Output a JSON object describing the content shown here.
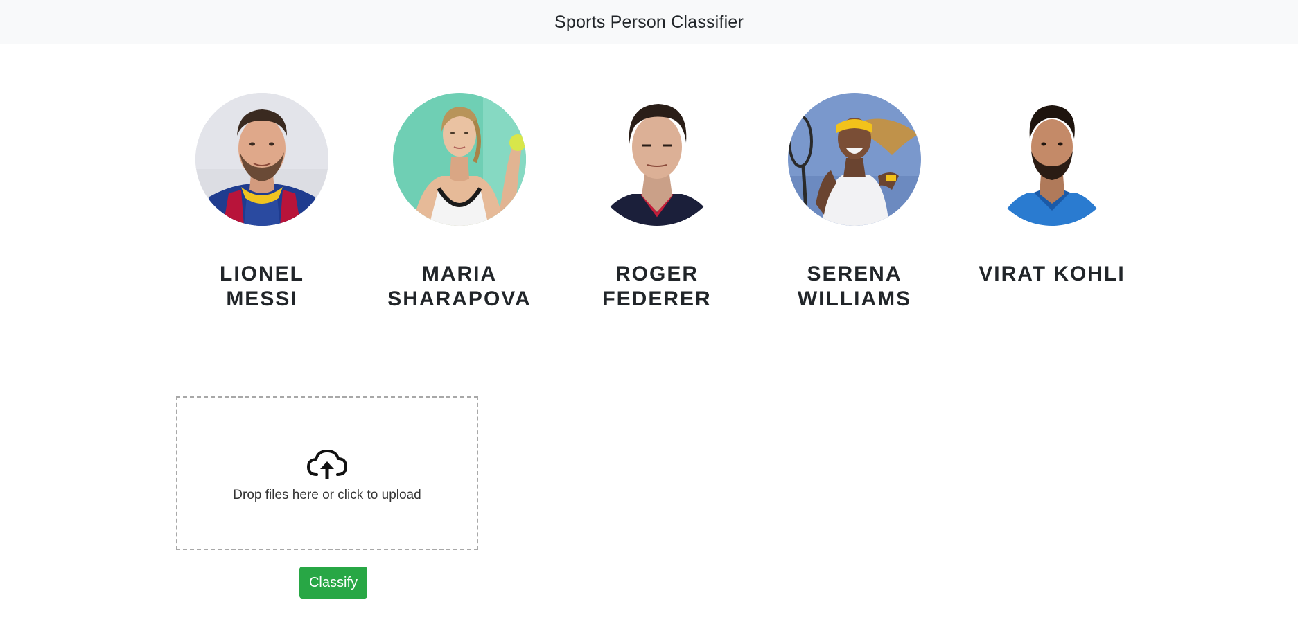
{
  "navbar": {
    "title": "Sports Person Classifier"
  },
  "players": [
    {
      "id": "lionel-messi",
      "name": "LIONEL MESSI",
      "photo_alt": "Lionel Messi photo"
    },
    {
      "id": "maria-sharapova",
      "name": "MARIA SHARAPOVA",
      "photo_alt": "Maria Sharapova photo"
    },
    {
      "id": "roger-federer",
      "name": "ROGER FEDERER",
      "photo_alt": "Roger Federer photo"
    },
    {
      "id": "serena-williams",
      "name": "SERENA WILLIAMS",
      "photo_alt": "Serena Williams photo"
    },
    {
      "id": "virat-kohli",
      "name": "VIRAT KOHLI",
      "photo_alt": "Virat Kohli photo"
    }
  ],
  "upload": {
    "icon": "cloud-upload-icon",
    "message": "Drop files here or click to upload"
  },
  "actions": {
    "classify_label": "Classify"
  },
  "colors": {
    "navbar_bg": "#f8f9fa",
    "classify_bg": "#28a745",
    "dropzone_border": "#a8a8a8"
  }
}
